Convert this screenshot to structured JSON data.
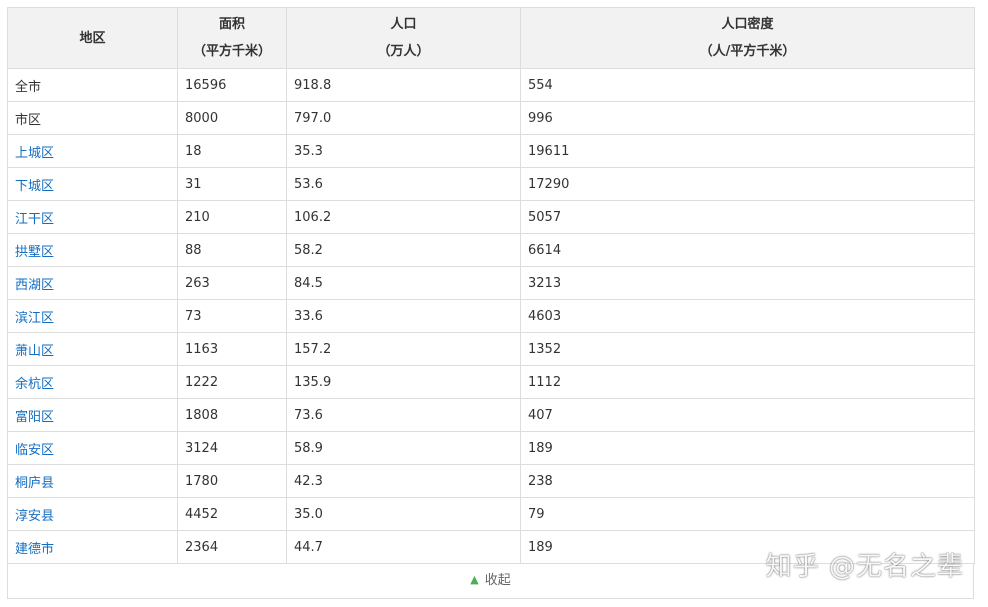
{
  "table": {
    "headers": [
      {
        "line1": "地区",
        "line2": ""
      },
      {
        "line1": "面积",
        "line2": "（平方千米）"
      },
      {
        "line1": "人口",
        "line2": "（万人）"
      },
      {
        "line1": "人口密度",
        "line2": "（人/平方千米）"
      }
    ],
    "rows": [
      {
        "region": "全市",
        "area": "16596",
        "population": "918.8",
        "density": "554",
        "link": false
      },
      {
        "region": "市区",
        "area": "8000",
        "population": "797.0",
        "density": "996",
        "link": false
      },
      {
        "region": "上城区",
        "area": "18",
        "population": "35.3",
        "density": "19611",
        "link": true
      },
      {
        "region": "下城区",
        "area": "31",
        "population": "53.6",
        "density": "17290",
        "link": true
      },
      {
        "region": "江干区",
        "area": "210",
        "population": "106.2",
        "density": "5057",
        "link": true
      },
      {
        "region": "拱墅区",
        "area": "88",
        "population": "58.2",
        "density": "6614",
        "link": true
      },
      {
        "region": "西湖区",
        "area": "263",
        "population": "84.5",
        "density": "3213",
        "link": true
      },
      {
        "region": "滨江区",
        "area": "73",
        "population": "33.6",
        "density": "4603",
        "link": true
      },
      {
        "region": "萧山区",
        "area": "1163",
        "population": "157.2",
        "density": "1352",
        "link": true
      },
      {
        "region": "余杭区",
        "area": "1222",
        "population": "135.9",
        "density": "1112",
        "link": true
      },
      {
        "region": "富阳区",
        "area": "1808",
        "population": "73.6",
        "density": "407",
        "link": true
      },
      {
        "region": "临安区",
        "area": "3124",
        "population": "58.9",
        "density": "189",
        "link": true
      },
      {
        "region": "桐庐县",
        "area": "1780",
        "population": "42.3",
        "density": "238",
        "link": true
      },
      {
        "region": "淳安县",
        "area": "4452",
        "population": "35.0",
        "density": "79",
        "link": true
      },
      {
        "region": "建德市",
        "area": "2364",
        "population": "44.7",
        "density": "189",
        "link": true
      }
    ]
  },
  "collapse_label": "收起",
  "collapse_icon": "chevron-up-icon",
  "watermark": "知乎 @无名之辈",
  "colors": {
    "link": "#136ec2",
    "header_bg": "#f2f2f2",
    "border": "#dddddd",
    "chevron": "#4cae4c"
  }
}
